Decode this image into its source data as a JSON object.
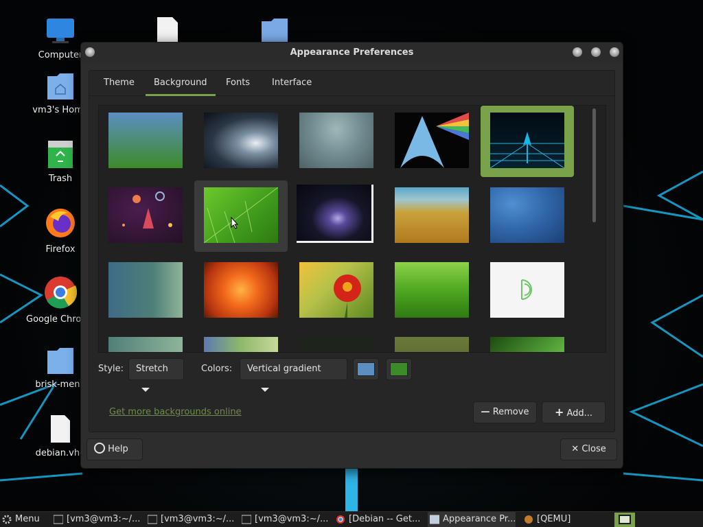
{
  "desktop": {
    "icons": [
      {
        "label": "Computer"
      },
      {
        "label": "vm3's Home"
      },
      {
        "label": "Trash"
      },
      {
        "label": "Firefox"
      },
      {
        "label": "Google Chrome"
      },
      {
        "label": "brisk-menu"
      },
      {
        "label": "debian.vhd"
      }
    ]
  },
  "window": {
    "title": "Appearance Preferences",
    "tabs": [
      {
        "label": "Theme"
      },
      {
        "label": "Background"
      },
      {
        "label": "Fonts"
      },
      {
        "label": "Interface"
      }
    ],
    "active_tab": "Background",
    "style_label": "Style:",
    "style_value": "Stretch",
    "colors_label": "Colors:",
    "colors_value": "Vertical gradient",
    "color1": "#5b8fc2",
    "color2": "#3d8b28",
    "more_link": "Get more backgrounds online",
    "remove_label": "Remove",
    "add_label": "Add...",
    "help_label": "Help",
    "close_label": "Close",
    "accent": "#7aa24b"
  },
  "taskbar": {
    "menu_label": "Menu",
    "tasks": [
      {
        "label": "[vm3@vm3:~/..."
      },
      {
        "label": "[vm3@vm3:~/..."
      },
      {
        "label": "[vm3@vm3:~/..."
      },
      {
        "label": "[Debian -- Get..."
      },
      {
        "label": "Appearance Pr..."
      },
      {
        "label": "[QEMU]"
      }
    ]
  }
}
